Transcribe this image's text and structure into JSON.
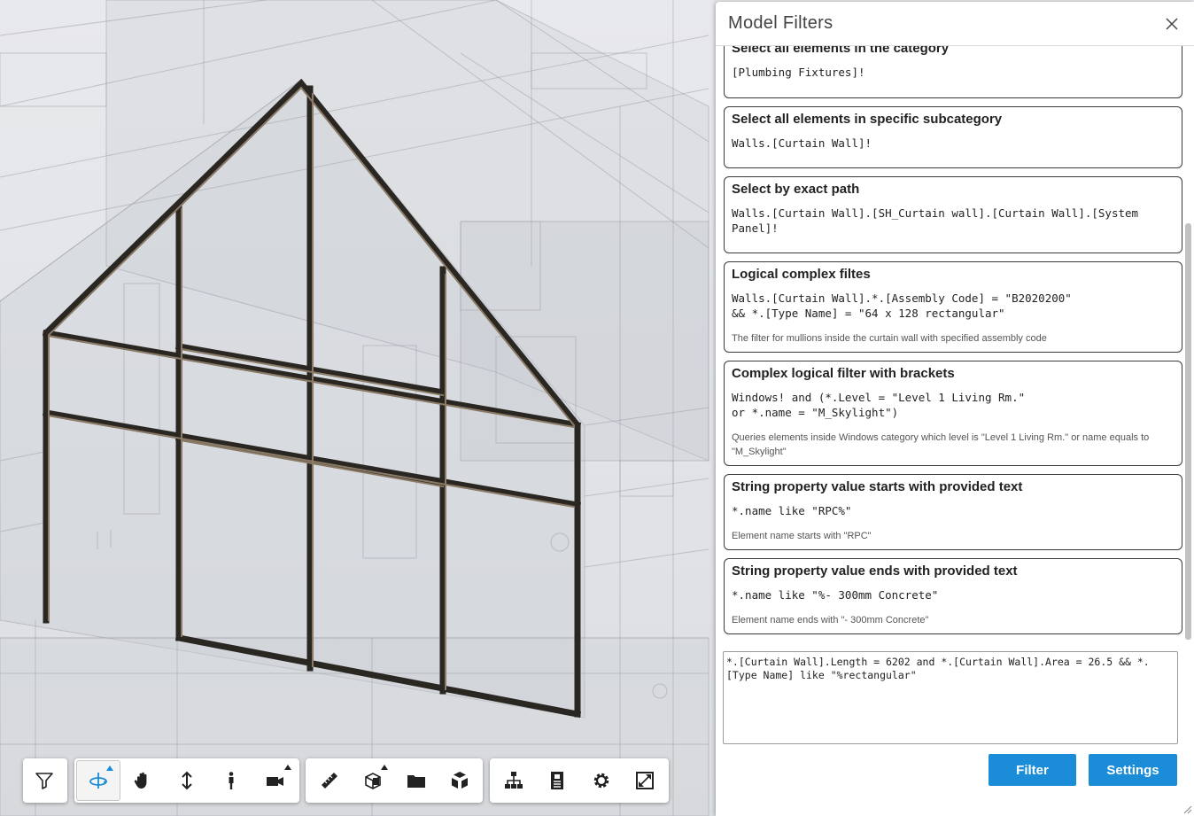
{
  "panel": {
    "title": "Model Filters",
    "close_label": "×"
  },
  "filters": [
    {
      "title": "Select all elements in the category",
      "code": "[Plumbing Fixtures]!",
      "description": ""
    },
    {
      "title": "Select all elements in specific subcategory",
      "code": "Walls.[Curtain Wall]!",
      "description": ""
    },
    {
      "title": "Select by exact path",
      "code": "Walls.[Curtain Wall].[SH_Curtain wall].[Curtain Wall].[System Panel]!",
      "description": ""
    },
    {
      "title": "Logical complex filtes",
      "code": "Walls.[Curtain Wall].*.[Assembly Code] = \"B2020200\"\n&& *.[Type Name] = \"64 x 128 rectangular\"",
      "description": "The filter for mullions inside the curtain wall with specified assembly code"
    },
    {
      "title": "Complex logical filter with brackets",
      "code": "Windows! and (*.Level = \"Level 1 Living Rm.\"\nor *.name = \"M_Skylight\")",
      "description": "Queries elements inside Windows category which level is \"Level 1 Living Rm.\" or name equals to \"M_Skylight\""
    },
    {
      "title": "String property value starts with provided text",
      "code": "*.name like \"RPC%\"",
      "description": "Element name starts with \"RPC\""
    },
    {
      "title": "String property value ends with provided text",
      "code": "*.name like \"%- 300mm Concrete\"",
      "description": "Element name ends with \"- 300mm Concrete\""
    }
  ],
  "query": {
    "value": "*.[Curtain Wall].Length = 6202 and *.[Curtain Wall].Area = 26.5 && *.[Type Name] like \"%rectangular\""
  },
  "buttons": {
    "filter": "Filter",
    "settings": "Settings"
  },
  "toolbar": {
    "groups": [
      [
        {
          "name": "model-filter",
          "icon": "filter-icon"
        }
      ],
      [
        {
          "name": "orbit",
          "icon": "orbit-icon",
          "active": true,
          "submenu": true
        },
        {
          "name": "pan",
          "icon": "hand-icon"
        },
        {
          "name": "zoom",
          "icon": "updown-arrow-icon"
        },
        {
          "name": "first-person",
          "icon": "person-icon"
        },
        {
          "name": "camera",
          "icon": "camera-icon",
          "submenu": true
        }
      ],
      [
        {
          "name": "measure",
          "icon": "ruler-icon"
        },
        {
          "name": "section",
          "icon": "section-box-icon",
          "submenu": true
        },
        {
          "name": "explode",
          "icon": "folder-icon"
        },
        {
          "name": "explode-model",
          "icon": "explode-cube-icon"
        }
      ],
      [
        {
          "name": "model-browser",
          "icon": "hierarchy-icon"
        },
        {
          "name": "properties",
          "icon": "properties-icon"
        },
        {
          "name": "settings",
          "icon": "gear-icon"
        },
        {
          "name": "fullscreen",
          "icon": "fullscreen-icon"
        }
      ]
    ]
  },
  "colors": {
    "accent": "#1a8cd8",
    "mullion": "#2a2622",
    "mullion_highlight": "#8a7a66"
  }
}
